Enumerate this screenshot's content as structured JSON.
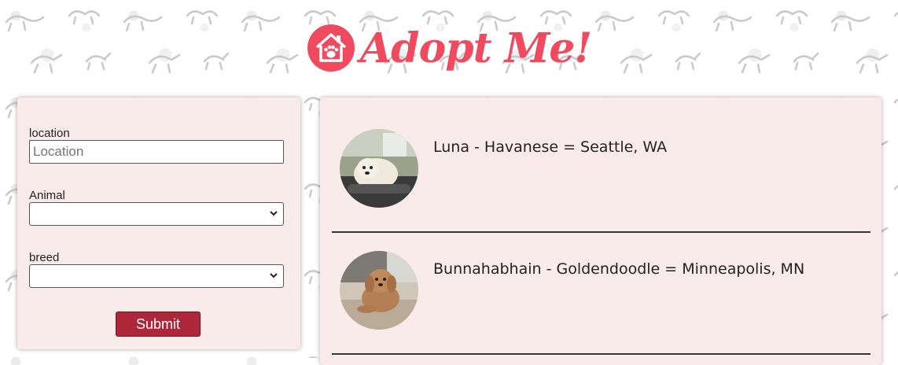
{
  "header": {
    "title": "Adopt Me!",
    "logo_icon": "house-paw-icon",
    "brand_color": "#f04a5f"
  },
  "search_form": {
    "location_label": "location",
    "location_placeholder": "Location",
    "location_value": "",
    "animal_label": "Animal",
    "animal_value": "",
    "breed_label": "breed",
    "breed_value": "",
    "submit_label": "Submit",
    "submit_color": "#ad2738"
  },
  "results": [
    {
      "text": "Luna - Havanese = Seattle, WA",
      "photo": "white-havanese-dog-photo"
    },
    {
      "text": "Bunnahabhain - Goldendoodle = Minneapolis, MN",
      "photo": "goldendoodle-dog-photo"
    }
  ]
}
